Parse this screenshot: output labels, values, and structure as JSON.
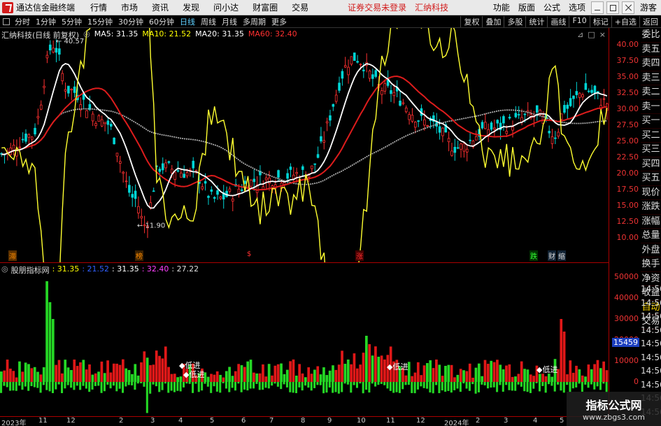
{
  "menubar": {
    "app_title": "通达信金融终端",
    "items": [
      "行情",
      "市场",
      "资讯",
      "发现",
      "问小达",
      "财富圈",
      "交易"
    ],
    "warning": "证券交易未登录",
    "stock_name": "汇纳科技",
    "tools": [
      "功能",
      "版面",
      "公式",
      "选项"
    ],
    "guest": "游客"
  },
  "toolbar": {
    "periods": [
      "分时",
      "1分钟",
      "5分钟",
      "15分钟",
      "30分钟",
      "60分钟",
      "日线",
      "周线",
      "月线",
      "多周期",
      "更多"
    ],
    "active": "日线",
    "right_buttons": [
      "复权",
      "叠加",
      "多股",
      "统计",
      "画线",
      "F10",
      "标记",
      "+自选",
      "返回"
    ]
  },
  "main_info": {
    "title": "汇纳科技(日线 前复权)",
    "ma5_label": "MA5: 31.35",
    "ma10_label": "MA10: 21.52",
    "ma20_label": "MA20: 31.35",
    "ma60_label": "MA60: 32.40",
    "colors": {
      "ma5": "#ffffff",
      "ma10": "#ffff00",
      "ma20": "#ffffff",
      "ma60": "#ff3030"
    }
  },
  "annotations": {
    "high": "40.57",
    "low": "11.90"
  },
  "price_ticks": [
    "40.00",
    "37.50",
    "35.00",
    "32.50",
    "30.00",
    "27.50",
    "25.00",
    "22.50",
    "20.00",
    "17.50",
    "15.00",
    "12.50",
    "10.00"
  ],
  "markers": [
    {
      "text": "滞",
      "color": "#ff8c00",
      "bg": "#5a3000"
    },
    {
      "text": "榜",
      "color": "#ff8c00",
      "bg": "#3a2000"
    },
    {
      "text": "$",
      "color": "#ff3030",
      "bg": "#000"
    },
    {
      "text": "涨",
      "color": "#ff3030",
      "bg": "#400"
    },
    {
      "text": "跌",
      "color": "#3f3",
      "bg": "#030"
    },
    {
      "text": "财",
      "color": "#ddd",
      "bg": "#123"
    },
    {
      "text": "缩",
      "color": "#ddd",
      "bg": "#123"
    }
  ],
  "lower_info": {
    "title": "股朋指标网",
    "v1": ": 31.35",
    "v2": ": 21.52",
    "v3": ": 31.35",
    "v4": ": 32.40",
    "v5": ": 27.22",
    "colors": {
      "v1": "#ffff00",
      "v2": "#3060ff",
      "v3": "#ffffff",
      "v4": "#ff40ff",
      "v5": "#dddddd"
    }
  },
  "volume_ticks": [
    "50000",
    "40000",
    "30000",
    "20000",
    "10000",
    "0"
  ],
  "volume_badge": "15459",
  "low_labels": [
    "低进",
    "低进",
    "低进",
    "低进"
  ],
  "right_col": [
    "委比",
    "卖五",
    "卖四",
    "卖三",
    "卖二",
    "卖一",
    "买一",
    "买二",
    "买三",
    "买四",
    "买五",
    "现价",
    "涨跌",
    "涨幅",
    "总量",
    "外盘",
    "换手",
    "净资",
    "收益",
    "自动",
    "交易"
  ],
  "time_col": [
    "14:56",
    "14:56",
    "14:56",
    "14:56",
    "14:56",
    "14:56",
    "14:56",
    "14:56",
    "14:56",
    "14:56"
  ],
  "dates": [
    "2023年",
    "11",
    "12",
    "2",
    "3",
    "4",
    "5",
    "6",
    "7",
    "8",
    "9",
    "10",
    "11",
    "12",
    "2024年",
    "2",
    "3",
    "4",
    "5"
  ],
  "watermark": {
    "line1": "指标公式网",
    "line2": "www.zbgs3.com"
  }
}
